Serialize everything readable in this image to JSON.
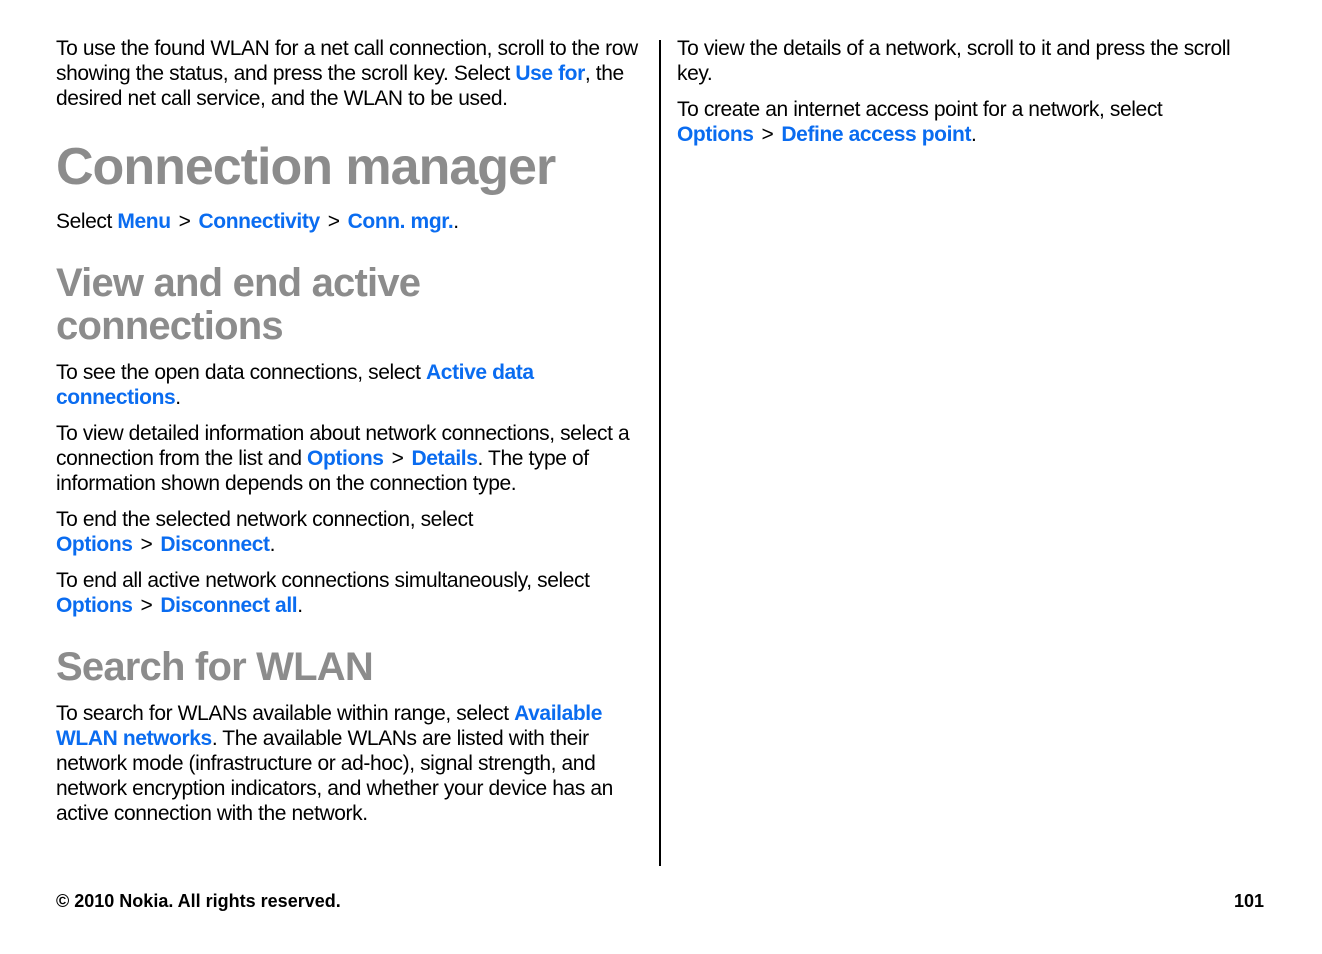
{
  "left": {
    "intro": {
      "pre": "To use the found WLAN for a net call connection, scroll to the row showing the status, and press the scroll key. Select ",
      "link": "Use for",
      "post": ", the desired net call service, and the WLAN to be used."
    },
    "title": "Connection manager",
    "nav": {
      "pre": "Select ",
      "items": [
        "Menu",
        "Connectivity",
        "Conn. mgr."
      ],
      "separator": ">",
      "post": "."
    },
    "section1": {
      "heading": "View and end active connections",
      "p1": {
        "pre": "To see the open data connections, select ",
        "link": "Active data connections",
        "post": "."
      },
      "p2": {
        "pre": "To view detailed information about network connections, select a connection from the list and ",
        "link1": "Options",
        "sep": ">",
        "link2": "Details",
        "post": ". The type of information shown depends on the connection type."
      },
      "p3": {
        "pre": "To end the selected network connection, select ",
        "link1": "Options",
        "sep": ">",
        "link2": "Disconnect",
        "post": "."
      },
      "p4": {
        "pre": "To end all active network connections simultaneously, select ",
        "link1": "Options",
        "sep": ">",
        "link2": "Disconnect all",
        "post": "."
      }
    },
    "section2": {
      "heading": "Search for WLAN",
      "p1": {
        "pre": "To search for WLANs available within range, select ",
        "link": "Available WLAN networks",
        "post": ". The available WLANs are listed with their network mode (infrastructure or ad-hoc), signal strength, and network encryption indicators, and whether your device has an active connection with the network."
      }
    }
  },
  "right": {
    "p1": "To view the details of a network, scroll to it and press the scroll key.",
    "p2": {
      "pre": "To create an internet access point for a network, select ",
      "link1": "Options",
      "sep": ">",
      "link2": "Define access point",
      "post": "."
    }
  },
  "footer": {
    "copyright": "© 2010 Nokia. All rights reserved.",
    "page_number": "101"
  },
  "colors": {
    "link": "#0a6cf0",
    "heading": "#8c8c8c",
    "text": "#000000"
  }
}
